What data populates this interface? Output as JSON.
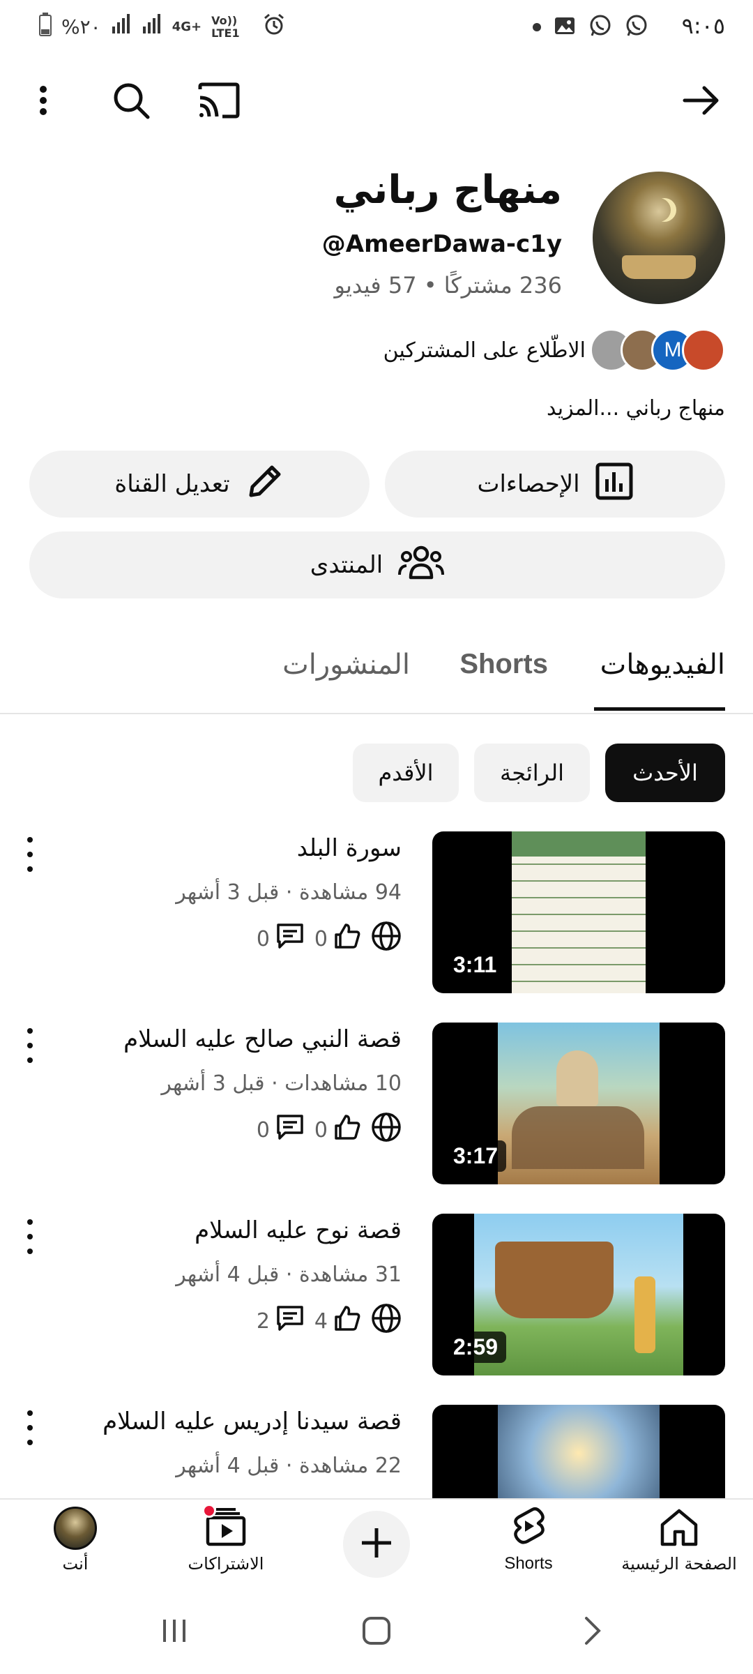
{
  "status_bar": {
    "time": "٩:٠٥",
    "battery": "%٢٠",
    "network": "4G+",
    "volte": "Vo)) LTE1"
  },
  "channel": {
    "name": "منهاج رباني",
    "handle": "@AmeerDawa-c1y",
    "stats": "236 مشتركًا • 57 فيديو",
    "subscribers_link": "الاطّلاع على المشتركين",
    "description": "منهاج رباني",
    "description_more": "...المزيد",
    "subscriber_avatar_letter": "M"
  },
  "actions": {
    "analytics": "الإحصاءات",
    "edit_channel": "تعديل القناة",
    "community": "المنتدى"
  },
  "tabs": {
    "videos": "الفيديوهات",
    "shorts": "Shorts",
    "posts": "المنشورات"
  },
  "chips": {
    "latest": "الأحدث",
    "popular": "الرائجة",
    "oldest": "الأقدم"
  },
  "videos": [
    {
      "title": "سورة البلد",
      "meta": "94 مشاهدة · قبل 3 أشهر",
      "duration": "3:11",
      "likes": "0",
      "comments": "0"
    },
    {
      "title": "قصة النبي صالح عليه السلام",
      "meta": "10 مشاهدات · قبل 3 أشهر",
      "duration": "3:17",
      "likes": "0",
      "comments": "0"
    },
    {
      "title": "قصة نوح عليه السلام",
      "meta": "31 مشاهدة · قبل 4 أشهر",
      "duration": "2:59",
      "likes": "4",
      "comments": "2"
    },
    {
      "title": "قصة سيدنا إدريس عليه السلام",
      "meta": "22 مشاهدة · قبل 4 أشهر",
      "duration": "",
      "likes": "",
      "comments": ""
    }
  ],
  "bottom_nav": {
    "home": "الصفحة الرئيسية",
    "shorts": "Shorts",
    "subscriptions": "الاشتراكات",
    "you": "أنت"
  },
  "icons": {
    "back": "arrow-right-icon",
    "cast": "cast-icon",
    "search": "search-icon",
    "more": "more-vert-icon"
  },
  "colors": {
    "accent_dark": "#0f0f0f",
    "chip_bg": "#f2f2f2",
    "secondary_text": "#606060",
    "notification_dot": "#e8173a"
  }
}
